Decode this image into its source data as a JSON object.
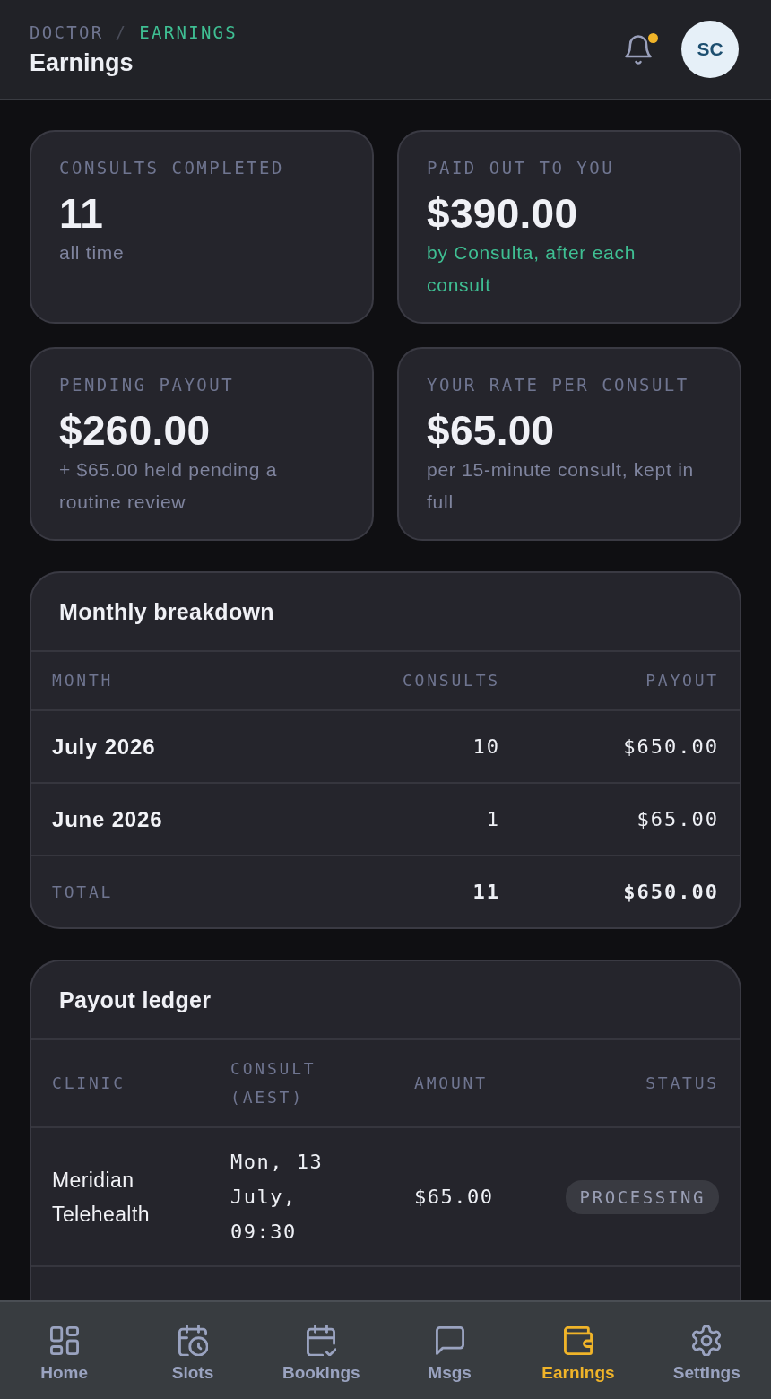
{
  "header": {
    "breadcrumb": [
      {
        "label": "DOCTOR",
        "selected": false
      },
      {
        "label": "EARNINGS",
        "selected": true
      }
    ],
    "separator": "/",
    "title": "Earnings",
    "notifications": {
      "unread": true
    },
    "avatar": {
      "initials": "SC"
    }
  },
  "stats": [
    {
      "label": "CONSULTS COMPLETED",
      "value": "11",
      "note": "all time",
      "kind": "plain"
    },
    {
      "label": "PAID OUT TO YOU",
      "value": "$390.00",
      "note": "by Consulta, after each consult",
      "kind": "highlight"
    },
    {
      "label": "PENDING PAYOUT",
      "value": "$260.00",
      "note": "+ $65.00 held pending a routine review",
      "kind": "plain"
    },
    {
      "label": "YOUR RATE PER CONSULT",
      "value": "$65.00",
      "note": "per 15-minute consult, kept in full",
      "kind": "plain"
    }
  ],
  "monthly_breakdown": {
    "title": "Monthly breakdown",
    "columns": [
      "MONTH",
      "CONSULTS",
      "PAYOUT"
    ],
    "rows": [
      {
        "month": "July 2026",
        "consults": "10",
        "payout": "$650.00"
      },
      {
        "month": "June 2026",
        "consults": "1",
        "payout": "$65.00"
      }
    ],
    "total": {
      "label": "TOTAL",
      "consults": "11",
      "payout": "$650.00"
    }
  },
  "payout_ledger": {
    "title": "Payout ledger",
    "columns": [
      "CLINIC",
      "CONSULT (AEST)",
      "AMOUNT",
      "STATUS"
    ],
    "rows": [
      {
        "clinic": "Meridian Telehealth",
        "consult": "Mon, 13 July, 09:30",
        "amount": "$65.00",
        "status": "PROCESSING"
      }
    ]
  },
  "nav": [
    {
      "label": "Home",
      "selected": false
    },
    {
      "label": "Slots",
      "selected": false
    },
    {
      "label": "Bookings",
      "selected": false
    },
    {
      "label": "Msgs",
      "selected": false
    },
    {
      "label": "Earnings",
      "selected": true
    },
    {
      "label": "Settings",
      "selected": false
    }
  ]
}
